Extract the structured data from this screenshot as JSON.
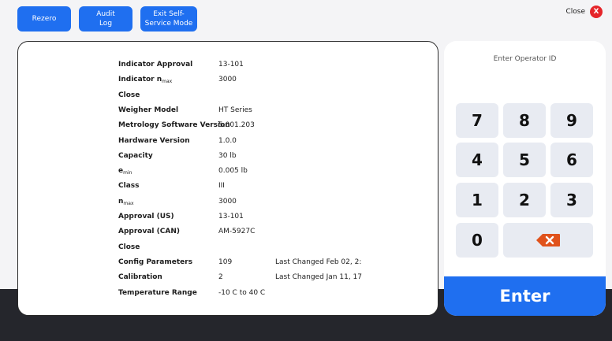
{
  "toolbar": {
    "rezero_label": "Rezero",
    "audit_label": "Audit Log",
    "exit_label": "Exit Self-Service Mode",
    "close_label": "Close",
    "close_icon": "X"
  },
  "info": {
    "rows": [
      {
        "label": "Indicator Approval",
        "value": "13-101"
      },
      {
        "label": "Indicator n",
        "label_sub": "max",
        "value": "3000"
      },
      {
        "label": "Close"
      },
      {
        "label": "Weigher Model",
        "value": "HT Series"
      },
      {
        "label": "Metrology Software Version",
        "value": "5.001.203"
      },
      {
        "label": "Hardware Version",
        "value": "1.0.0"
      },
      {
        "label": "Capacity",
        "value": "30 lb"
      },
      {
        "label": "e",
        "label_sub": "min",
        "value": "0.005 lb"
      },
      {
        "label": "Class",
        "value": "III"
      },
      {
        "label": "n",
        "label_sub": "max",
        "value": "3000"
      },
      {
        "label": "Approval (US)",
        "value": "13-101"
      },
      {
        "label": "Approval (CAN)",
        "value": "AM-5927C"
      },
      {
        "label": "Close"
      },
      {
        "label": "Config Parameters",
        "value": "109",
        "extra": "Last Changed Feb 02, 2:"
      },
      {
        "label": "Calibration",
        "value": "2",
        "extra": "Last Changed Jan 11, 17"
      },
      {
        "label": "Temperature Range",
        "value": "-10 C to 40 C"
      }
    ]
  },
  "keypad": {
    "title": "Enter Operator ID",
    "keys": [
      "7",
      "8",
      "9",
      "4",
      "5",
      "6",
      "1",
      "2",
      "3",
      "0"
    ],
    "backspace_icon": "backspace-icon",
    "enter_label": "Enter"
  },
  "colors": {
    "accent": "#1f6ff0",
    "close": "#e5252a",
    "backspace": "#e0521b",
    "bottom_band": "#25262c"
  }
}
